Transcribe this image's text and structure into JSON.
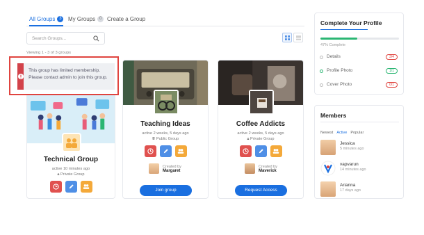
{
  "tabs": [
    {
      "label": "All Groups",
      "count": "3"
    },
    {
      "label": "My Groups",
      "count": "0"
    },
    {
      "label": "Create a Group"
    }
  ],
  "search": {
    "placeholder": "Search Groups..."
  },
  "viewing_text": "Viewing 1 - 3 of 3 groups",
  "alert": {
    "message": "This group has limited membership. Please contact admin to join this group."
  },
  "groups": [
    {
      "name": "Technical Group",
      "activity": "active 10 minutes ago",
      "privacy": "Private Group"
    },
    {
      "name": "Teaching Ideas",
      "activity": "active 2 weeks, 5 days ago",
      "privacy": "Public Group",
      "created_by_label": "Created by",
      "creator": "Margaret",
      "button": "Join group"
    },
    {
      "name": "Coffee Addicts",
      "activity": "active 2 weeks, 5 days ago",
      "privacy": "Private Group",
      "created_by_label": "Created by",
      "creator": "Maverick",
      "button": "Request Access"
    }
  ],
  "profile": {
    "title": "Complete Your Profile",
    "progress_percent": 47,
    "progress_text": "47% Complete",
    "items": [
      {
        "label": "Details",
        "status": "3/4",
        "color": "#e0443f"
      },
      {
        "label": "Profile Photo",
        "status": "1/1",
        "color": "#2bb673"
      },
      {
        "label": "Cover Photo",
        "status": "0/1",
        "color": "#e0443f"
      }
    ]
  },
  "members": {
    "title": "Members",
    "filters": {
      "newest": "Newest",
      "active": "Active",
      "popular": "Popular"
    },
    "list": [
      {
        "name": "Jessica",
        "time": "5 minutes ago"
      },
      {
        "name": "vapvarun",
        "time": "14 minutes ago"
      },
      {
        "name": "Arianna",
        "time": "17 days ago"
      }
    ]
  },
  "colors": {
    "accent": "#1a6fe0",
    "alert_border": "#e0443f",
    "progress": "#2bb673"
  }
}
